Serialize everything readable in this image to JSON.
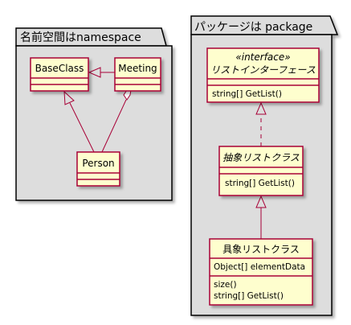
{
  "colors": {
    "package_fill": "#dddddd",
    "package_border": "#000000",
    "class_fill": "#fefece",
    "class_border": "#a80036",
    "relation_line": "#a80036"
  },
  "packages": [
    {
      "title": "名前空間はnamespace",
      "classes": {
        "baseclass": {
          "name": "BaseClass"
        },
        "meeting": {
          "name": "Meeting"
        },
        "person": {
          "name": "Person"
        }
      },
      "relations": [
        {
          "from": "Meeting",
          "to": "BaseClass",
          "type": "inheritance"
        },
        {
          "from": "Person",
          "to": "BaseClass",
          "type": "inheritance"
        },
        {
          "from": "Person",
          "to": "Meeting",
          "type": "aggregation"
        }
      ]
    },
    {
      "title": "パッケージは package",
      "classes": {
        "interface": {
          "stereotype": "«interface»",
          "name": "リストインターフェース",
          "methods": [
            "string[] GetList()"
          ]
        },
        "abstract": {
          "name": "抽象リストクラス",
          "methods": [
            "string[] GetList()"
          ]
        },
        "concrete": {
          "name": "具象リストクラス",
          "fields": [
            "Object[] elementData"
          ],
          "methods": [
            "size()",
            "string[] GetList()"
          ]
        }
      },
      "relations": [
        {
          "from": "抽象リストクラス",
          "to": "リストインターフェース",
          "type": "realization"
        },
        {
          "from": "具象リストクラス",
          "to": "抽象リストクラス",
          "type": "inheritance"
        }
      ]
    }
  ]
}
